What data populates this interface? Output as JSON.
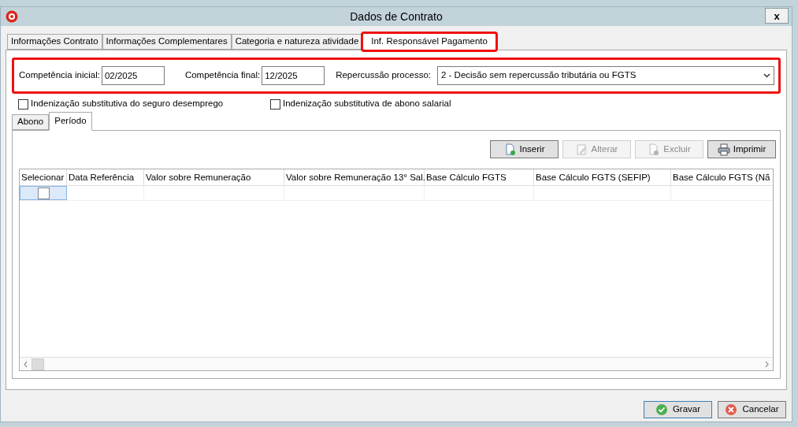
{
  "window": {
    "title": "Dados de Contrato",
    "close": "x"
  },
  "tabs": [
    {
      "label": "Informações Contrato",
      "selected": false,
      "highlighted": false
    },
    {
      "label": "Informações Complementares",
      "selected": false,
      "highlighted": false
    },
    {
      "label": "Categoria e natureza atividade",
      "selected": false,
      "highlighted": false
    },
    {
      "label": "Inf. Responsável Pagamento",
      "selected": true,
      "highlighted": true
    }
  ],
  "fields_highlighted": true,
  "fields": [
    {
      "kind": "text",
      "label": "Competência inicial:",
      "value": "02/2025"
    },
    {
      "kind": "text",
      "label": "Competência final:",
      "value": "12/2025"
    },
    {
      "kind": "select",
      "label": "Repercussão processo:",
      "value": "2 - Decisão sem repercussão tributária ou FGTS"
    }
  ],
  "checkboxes": [
    {
      "label": "Indenização substitutiva do seguro desemprego",
      "checked": false
    },
    {
      "label": "Indenização substitutiva de abono salarial",
      "checked": false
    }
  ],
  "inner_tabs": [
    {
      "label": "Abono",
      "selected": false
    },
    {
      "label": "Período",
      "selected": true
    }
  ],
  "toolbar": [
    {
      "label": "Inserir",
      "disabled": false,
      "kind": "new"
    },
    {
      "label": "Alterar",
      "disabled": true,
      "kind": "edit"
    },
    {
      "label": "Excluir",
      "disabled": true,
      "kind": "delete"
    },
    {
      "label": "Imprimir",
      "disabled": false,
      "kind": "print"
    }
  ],
  "grid": {
    "columns": [
      "Selecionar",
      "Data Referência",
      "Valor sobre Remuneração",
      "Valor sobre Remuneração 13° Sal.",
      "Base Cálculo FGTS",
      "Base Cálculo FGTS (SEFIP)",
      "Base Cálculo FGTS (Nã"
    ],
    "rows": [
      {
        "checked": false,
        "focused": true
      }
    ]
  },
  "buttons": [
    {
      "label": "Gravar",
      "kind": "ok"
    },
    {
      "label": "Cancelar",
      "kind": "cancel"
    }
  ]
}
